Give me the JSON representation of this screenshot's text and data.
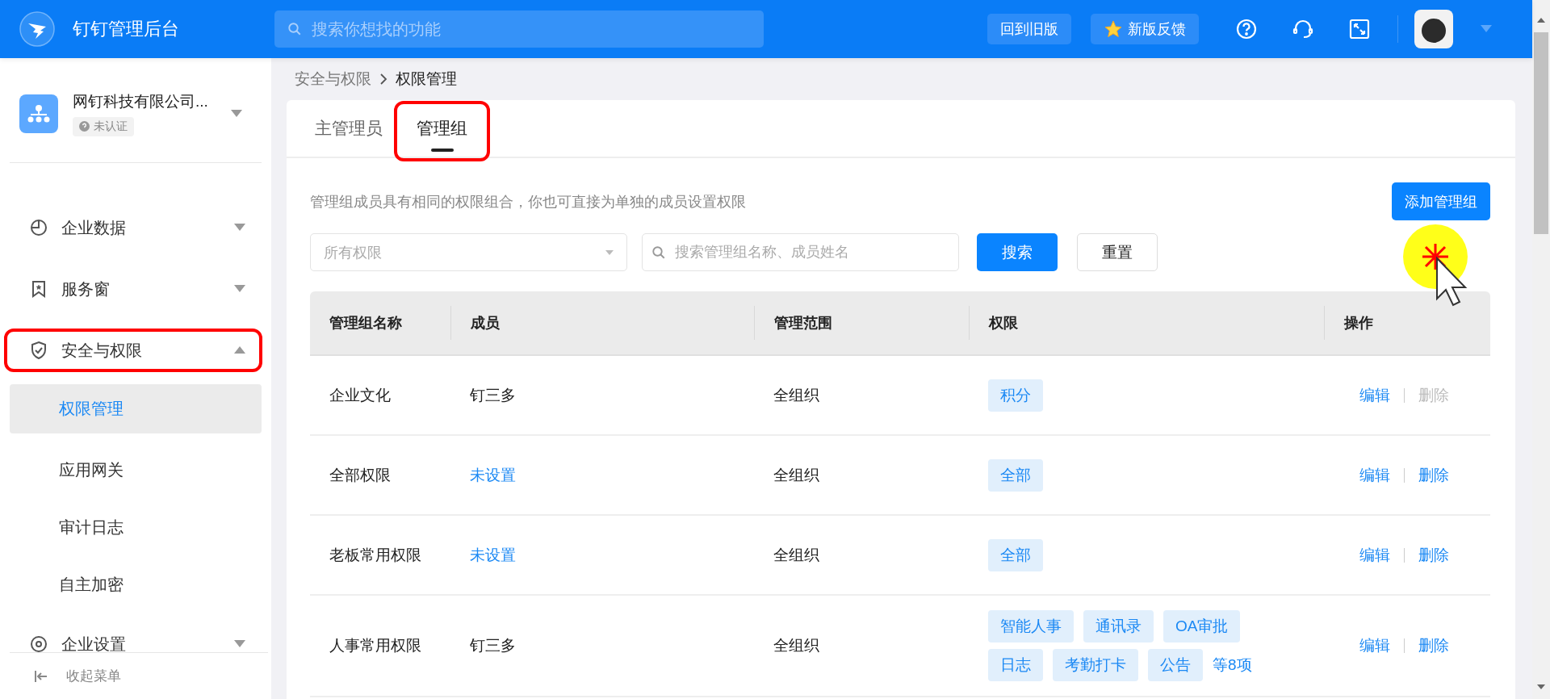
{
  "header": {
    "title": "钉钉管理后台",
    "search_placeholder": "搜索你想找的功能",
    "buttons": [
      {
        "label": "回到旧版",
        "kind": "plain"
      },
      {
        "label": "新版反馈",
        "kind": "star"
      }
    ]
  },
  "sidebar": {
    "org": {
      "name": "网钉科技有限公司...",
      "badge": "未认证"
    },
    "items": [
      {
        "label": "企业数据",
        "expanded": false,
        "highlighted": false
      },
      {
        "label": "服务窗",
        "expanded": false,
        "highlighted": false
      },
      {
        "label": "安全与权限",
        "expanded": true,
        "highlighted": true,
        "children": [
          {
            "label": "权限管理",
            "selected": true
          },
          {
            "label": "应用网关",
            "selected": false
          },
          {
            "label": "审计日志",
            "selected": false
          },
          {
            "label": "自主加密",
            "selected": false
          }
        ]
      },
      {
        "label": "企业设置",
        "expanded": false,
        "highlighted": false
      }
    ],
    "collapse": "收起菜单"
  },
  "breadcrumb": [
    "安全与权限",
    "权限管理"
  ],
  "tabs": [
    {
      "label": "主管理员",
      "selected": false,
      "highlighted": false
    },
    {
      "label": "管理组",
      "selected": true,
      "highlighted": true
    }
  ],
  "description": "管理组成员具有相同的权限组合，你也可直接为单独的成员设置权限",
  "add_button": "添加管理组",
  "filters": {
    "select_placeholder": "所有权限",
    "search_placeholder": "搜索管理组名称、成员姓名",
    "search_button": "搜索",
    "reset_button": "重置"
  },
  "table": {
    "columns": [
      "管理组名称",
      "成员",
      "管理范围",
      "权限",
      "操作"
    ],
    "rows": [
      {
        "name": "企业文化",
        "member": "钉三多",
        "unset": false,
        "scope": "全组织",
        "permissions": [
          "积分"
        ],
        "more": null,
        "edit": "编辑",
        "delete": {
          "label": "删除",
          "disabled": true
        }
      },
      {
        "name": "全部权限",
        "member": "未设置",
        "unset": true,
        "scope": "全组织",
        "permissions": [
          "全部"
        ],
        "more": null,
        "edit": "编辑",
        "delete": {
          "label": "删除",
          "disabled": false
        }
      },
      {
        "name": "老板常用权限",
        "member": "未设置",
        "unset": true,
        "scope": "全组织",
        "permissions": [
          "全部"
        ],
        "more": null,
        "edit": "编辑",
        "delete": {
          "label": "删除",
          "disabled": false
        }
      },
      {
        "name": "人事常用权限",
        "member": "钉三多",
        "unset": false,
        "scope": "全组织",
        "permissions": [
          "智能人事",
          "通讯录",
          "OA审批",
          "日志",
          "考勤打卡",
          "公告"
        ],
        "more": "等8项",
        "edit": "编辑",
        "delete": {
          "label": "删除",
          "disabled": false
        }
      }
    ]
  }
}
